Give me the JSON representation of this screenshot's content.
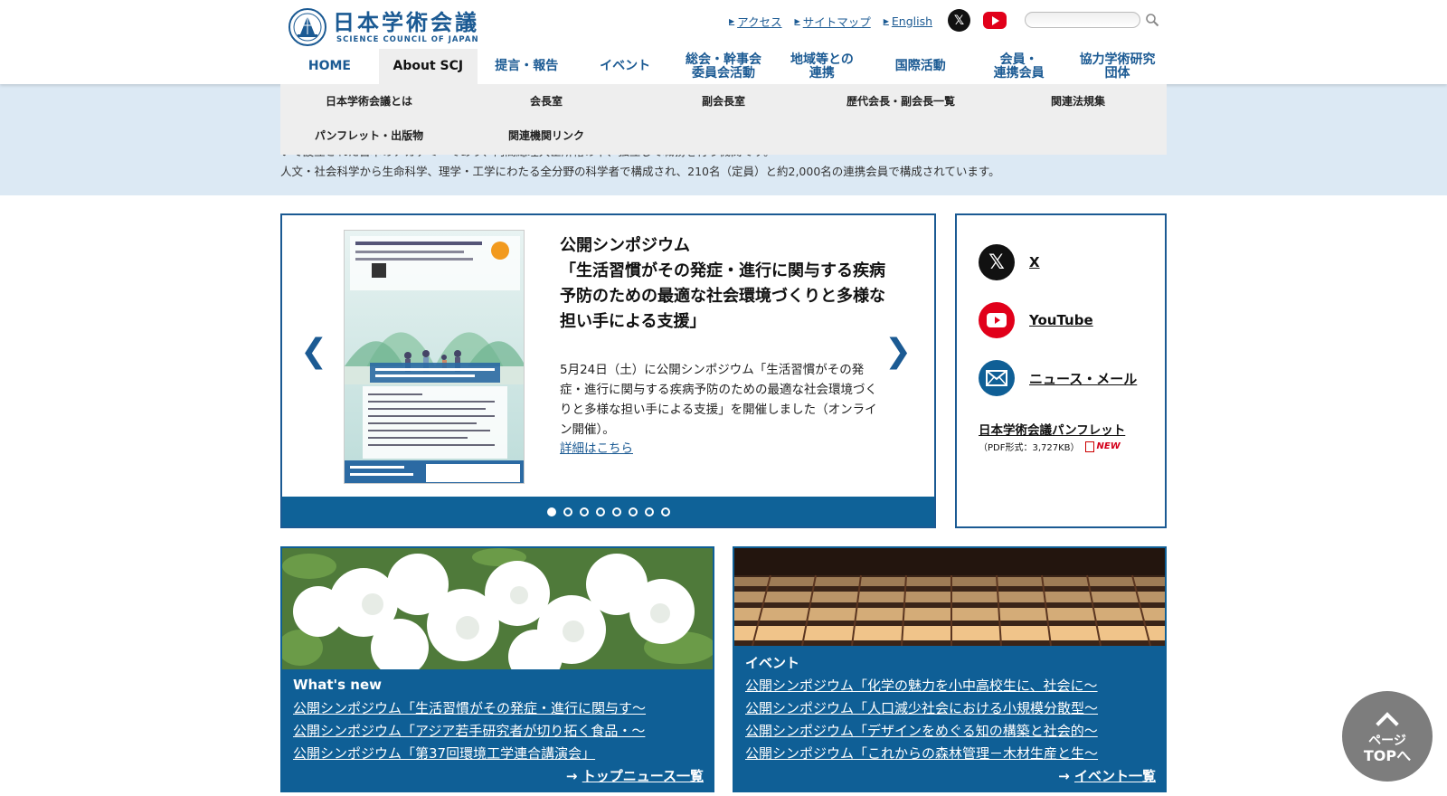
{
  "header": {
    "logo_jp": "日本学術会議",
    "logo_en": "SCIENCE COUNCIL OF JAPAN",
    "util_links": [
      "アクセス",
      "サイトマップ",
      "English"
    ],
    "search_placeholder": ""
  },
  "gnav": [
    "HOME",
    "About SCJ",
    "提言・報告",
    "イベント",
    "総会・幹事会\n委員会活動",
    "地域等との\n連携",
    "国際活動",
    "会員・\n連携会員",
    "協力学術研究\n団体"
  ],
  "dropdown": {
    "row1": [
      "日本学術会議とは",
      "会長室",
      "副会長室",
      "歴代会長・副会長一覧",
      "関連法規集"
    ],
    "row2": [
      "パンフレット・出版物",
      "関連機関リンク"
    ]
  },
  "intro": {
    "line1": "いて設立された日本のアカデミーであり、内閣総理大臣所轄の下、独立して職務を行う機関です。",
    "line2": "人文・社会科学から生命科学、理学・工学にわたる全分野の科学者で構成され、210名（定員）と約2,000名の連携会員で構成されています。"
  },
  "slider": {
    "title": "公開シンポジウム\n「生活習慣がその発症・進行に関与する疾病予防のための最適な社会環境づくりと多様な担い手による支援」",
    "desc": "5月24日（土）に公開シンポジウム「生活習慣がその発症・進行に関与する疾病予防のための最適な社会環境づくりと多様な担い手による支援」を開催しました（オンライン開催）。",
    "more": "詳細はこちら",
    "prev": "❮",
    "next": "❯",
    "dots": 8,
    "active_dot": 0
  },
  "social": {
    "x": "X",
    "youtube": "YouTube",
    "news": "ニュース・メール",
    "pamphlet": "日本学術会議パンフレット",
    "pamphlet_sub": "（PDF形式：3,727KB）",
    "new_badge": "NEW"
  },
  "whatsnew": {
    "head": "What's new",
    "links": [
      "公開シンポジウム「生活習慣がその発症・進行に関与す〜",
      "公開シンポジウム「アジア若手研究者が切り拓く食品・〜",
      "公開シンポジウム「第37回環境工学連合講演会」"
    ],
    "more_arrow": "→",
    "more": "トップニュース一覧"
  },
  "events": {
    "head": "イベント",
    "links": [
      "公開シンポジウム「化学の魅力を小中高校生に、社会に〜",
      "公開シンポジウム「人口減少社会における小規模分散型〜",
      "公開シンポジウム「デザインをめぐる知の構築と社会的〜",
      "公開シンポジウム「これからの森林管理－木材生産と生〜"
    ],
    "more_arrow": "→",
    "more": "イベント一覧"
  },
  "pagetop": {
    "line1": "ページ",
    "line2": "TOPへ"
  },
  "colors": {
    "brand_blue": "#1b5a93",
    "panel_blue": "#0f5f96",
    "band_bg": "#dce9f4",
    "youtube_red": "#e1001a"
  }
}
